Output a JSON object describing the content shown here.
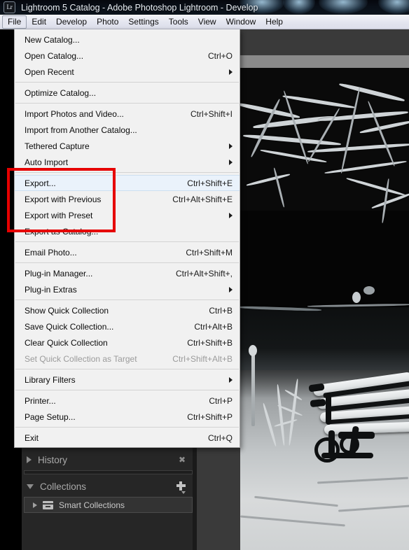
{
  "window": {
    "title": "Lightroom 5 Catalog - Adobe Photoshop Lightroom - Develop",
    "app_icon": "lightroom-icon",
    "app_icon_label": "Lr"
  },
  "menubar": {
    "items": [
      {
        "label": "File",
        "active": true
      },
      {
        "label": "Edit",
        "active": false
      },
      {
        "label": "Develop",
        "active": false
      },
      {
        "label": "Photo",
        "active": false
      },
      {
        "label": "Settings",
        "active": false
      },
      {
        "label": "Tools",
        "active": false
      },
      {
        "label": "View",
        "active": false
      },
      {
        "label": "Window",
        "active": false
      },
      {
        "label": "Help",
        "active": false
      }
    ]
  },
  "file_menu": {
    "open": true,
    "groups": [
      {
        "items": [
          {
            "label": "New Catalog...",
            "accel": "",
            "submenu": false,
            "disabled": false,
            "hover": false
          },
          {
            "label": "Open Catalog...",
            "accel": "Ctrl+O",
            "submenu": false,
            "disabled": false,
            "hover": false
          },
          {
            "label": "Open Recent",
            "accel": "",
            "submenu": true,
            "disabled": false,
            "hover": false
          }
        ]
      },
      {
        "items": [
          {
            "label": "Optimize Catalog...",
            "accel": "",
            "submenu": false,
            "disabled": false,
            "hover": false
          }
        ]
      },
      {
        "items": [
          {
            "label": "Import Photos and Video...",
            "accel": "Ctrl+Shift+I",
            "submenu": false,
            "disabled": false,
            "hover": false
          },
          {
            "label": "Import from Another Catalog...",
            "accel": "",
            "submenu": false,
            "disabled": false,
            "hover": false
          },
          {
            "label": "Tethered Capture",
            "accel": "",
            "submenu": true,
            "disabled": false,
            "hover": false
          },
          {
            "label": "Auto Import",
            "accel": "",
            "submenu": true,
            "disabled": false,
            "hover": false
          }
        ]
      },
      {
        "items": [
          {
            "label": "Export...",
            "accel": "Ctrl+Shift+E",
            "submenu": false,
            "disabled": false,
            "hover": true
          },
          {
            "label": "Export with Previous",
            "accel": "Ctrl+Alt+Shift+E",
            "submenu": false,
            "disabled": false,
            "hover": false
          },
          {
            "label": "Export with Preset",
            "accel": "",
            "submenu": true,
            "disabled": false,
            "hover": false
          },
          {
            "label": "Export as Catalog...",
            "accel": "",
            "submenu": false,
            "disabled": false,
            "hover": false
          }
        ]
      },
      {
        "items": [
          {
            "label": "Email Photo...",
            "accel": "Ctrl+Shift+M",
            "submenu": false,
            "disabled": false,
            "hover": false
          }
        ]
      },
      {
        "items": [
          {
            "label": "Plug-in Manager...",
            "accel": "Ctrl+Alt+Shift+,",
            "submenu": false,
            "disabled": false,
            "hover": false
          },
          {
            "label": "Plug-in Extras",
            "accel": "",
            "submenu": true,
            "disabled": false,
            "hover": false
          }
        ]
      },
      {
        "items": [
          {
            "label": "Show Quick Collection",
            "accel": "Ctrl+B",
            "submenu": false,
            "disabled": false,
            "hover": false
          },
          {
            "label": "Save Quick Collection...",
            "accel": "Ctrl+Alt+B",
            "submenu": false,
            "disabled": false,
            "hover": false
          },
          {
            "label": "Clear Quick Collection",
            "accel": "Ctrl+Shift+B",
            "submenu": false,
            "disabled": false,
            "hover": false
          },
          {
            "label": "Set Quick Collection as Target",
            "accel": "Ctrl+Shift+Alt+B",
            "submenu": false,
            "disabled": true,
            "hover": false
          }
        ]
      },
      {
        "items": [
          {
            "label": "Library Filters",
            "accel": "",
            "submenu": true,
            "disabled": false,
            "hover": false
          }
        ]
      },
      {
        "items": [
          {
            "label": "Printer...",
            "accel": "Ctrl+P",
            "submenu": false,
            "disabled": false,
            "hover": false
          },
          {
            "label": "Page Setup...",
            "accel": "Ctrl+Shift+P",
            "submenu": false,
            "disabled": false,
            "hover": false
          }
        ]
      },
      {
        "items": [
          {
            "label": "Exit",
            "accel": "Ctrl+Q",
            "submenu": false,
            "disabled": false,
            "hover": false
          }
        ]
      }
    ]
  },
  "annotation": {
    "type": "red-rectangle-highlight",
    "color": "#e60000",
    "targets": [
      "Export...",
      "Export with Previous",
      "Export with Preset",
      "Export as Catalog..."
    ]
  },
  "left_panel": {
    "history": {
      "label": "History",
      "expanded": false,
      "close_icon": "close-icon"
    },
    "collections": {
      "label": "Collections",
      "expanded": true,
      "add_icon": "plus-icon",
      "items": [
        {
          "label": "Smart Collections",
          "expanded": false,
          "icon": "box-icon"
        }
      ]
    }
  },
  "photo": {
    "description": "Snow-covered park bench at night with snowy branches",
    "alt": "winter-night-bench-photo"
  }
}
